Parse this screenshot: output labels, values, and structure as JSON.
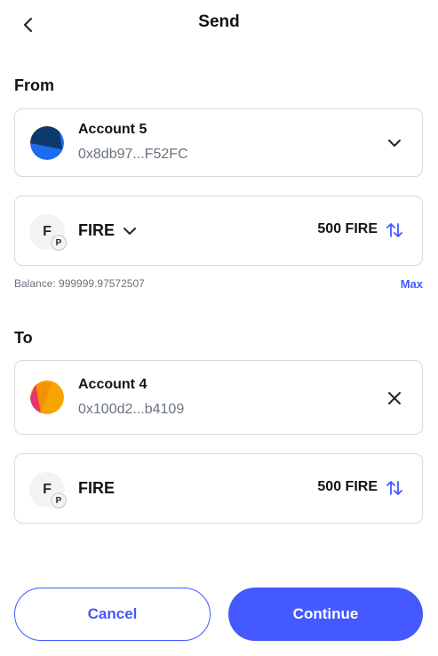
{
  "header": {
    "title": "Send",
    "back_icon": "chevron-left-icon"
  },
  "from": {
    "label": "From",
    "account": {
      "name": "Account 5",
      "address": "0x8db97...F52FC",
      "avatar_colors": [
        "#0e3a6b",
        "#1f6bf0"
      ]
    },
    "asset": {
      "token_letter": "F",
      "network_letter": "P",
      "symbol": "FIRE",
      "amount": "500 FIRE"
    },
    "balance": "Balance: 999999.97572507",
    "max_label": "Max"
  },
  "to": {
    "label": "To",
    "account": {
      "name": "Account 4",
      "address": "0x100d2...b4109",
      "avatar_colors": [
        "#f7a400",
        "#e8336f"
      ]
    },
    "asset": {
      "token_letter": "F",
      "network_letter": "P",
      "symbol": "FIRE",
      "amount": "500 FIRE"
    }
  },
  "footer": {
    "cancel_label": "Cancel",
    "continue_label": "Continue"
  },
  "colors": {
    "accent": "#4459ff",
    "border": "#d6d9dc",
    "muted_text": "#6a737d"
  }
}
